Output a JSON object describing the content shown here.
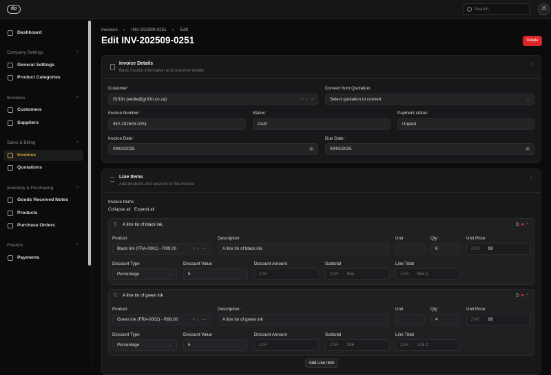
{
  "header": {
    "search_placeholder": "Search",
    "avatar_initials": "JS",
    "logo": "dp"
  },
  "sidebar": {
    "dashboard": "Dashboard",
    "sections": [
      {
        "title": "Company Settings",
        "items": [
          "General Settings",
          "Product Categories"
        ]
      },
      {
        "title": "Business",
        "items": [
          "Customers",
          "Suppliers"
        ]
      },
      {
        "title": "Sales & Billing",
        "items": [
          "Invoices",
          "Quotations"
        ]
      },
      {
        "title": "Inventory & Purchasing",
        "items": [
          "Goods Received Notes",
          "Products",
          "Purchase Orders"
        ]
      },
      {
        "title": "Finance",
        "items": [
          "Payments"
        ]
      }
    ],
    "active": "Invoices"
  },
  "breadcrumb": [
    "Invoices",
    "INV-202509-0251",
    "Edit"
  ],
  "page_title": "Edit INV-202509-0251",
  "delete_label": "Delete",
  "invoice_details": {
    "title": "Invoice Details",
    "subtitle": "Basic invoice information and customer details",
    "customer_label": "Customer",
    "customer_value": "Gr33n (eddie@gr33n.co.za)",
    "convert_label": "Convert from Quotation",
    "convert_placeholder": "Select quotation to convert",
    "number_label": "Invoice Number",
    "number_value": "INV-202509-0251",
    "status_label": "Status",
    "status_value": "Draft",
    "payment_label": "Payment status",
    "payment_value": "Unpaid",
    "date_label": "Invoice Date",
    "date_value": "09/03/2025",
    "due_label": "Due Date",
    "due_value": "09/05/2025"
  },
  "line_items": {
    "title": "Line Items",
    "subtitle": "Add products and services to this invoice",
    "section_label": "Invoice Items",
    "collapse_all": "Collapse all",
    "expand_all": "Expand all",
    "labels": {
      "product": "Product",
      "description": "Description",
      "unit": "Unit",
      "qty": "Qty",
      "unit_price": "Unit Price",
      "discount_type": "Discount Type",
      "discount_value": "Discount Value",
      "discount_amount": "Discount Amount",
      "subtotal": "Subtotal",
      "line_total": "Line Total"
    },
    "currency": "ZAR",
    "items": [
      {
        "title": "A litre tin of black ink.",
        "product": "Black Ink (FRA-0001) - R99.00",
        "description": "A litre tin of black ink.",
        "unit": "",
        "qty": "6",
        "unit_price": "99",
        "discount_type": "Percentage",
        "discount_value": "5",
        "discount_amount": "",
        "subtotal": "594",
        "line_total": "564.3"
      },
      {
        "title": "A litre tin of green ink",
        "product": "Green Ink (FRA-0002) - R99.00",
        "description": "A litre tin of green ink",
        "unit": "",
        "qty": "4",
        "unit_price": "99",
        "discount_type": "Percentage",
        "discount_value": "5",
        "discount_amount": "",
        "subtotal": "396",
        "line_total": "376.2"
      }
    ],
    "add_label": "Add Line Item"
  }
}
